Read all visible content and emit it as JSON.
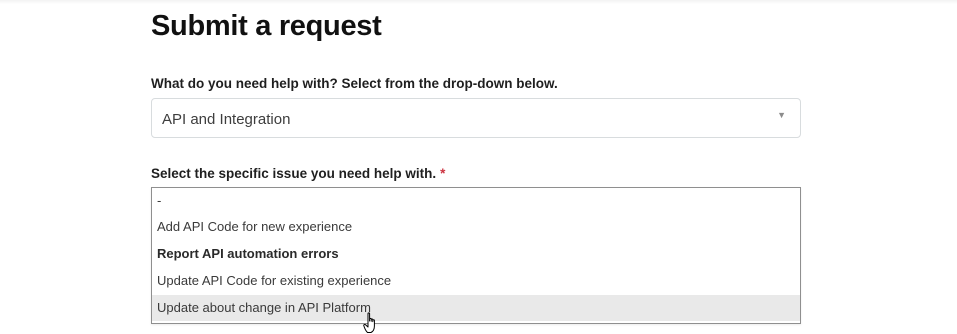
{
  "page": {
    "title": "Submit a request"
  },
  "form": {
    "help_topic": {
      "label": "What do you need help with? Select from the drop-down below.",
      "selected": "API and Integration",
      "arrow_icon": "triangle-down-icon"
    },
    "issue": {
      "label": "Select the specific issue you need help with.",
      "required_marker": "*",
      "options": [
        "-",
        "Add API Code for new experience",
        "Report API automation errors",
        "Update API Code for existing experience",
        "Update about change in API Platform"
      ],
      "selected_option": "Report API automation errors",
      "hovered_option": "Update about change in API Platform"
    }
  },
  "colors": {
    "required": "#cc3340",
    "hover_bg": "#e9e9e9",
    "border": "#d8dcde"
  },
  "cursor": {
    "icon": "hand-pointer-icon"
  }
}
